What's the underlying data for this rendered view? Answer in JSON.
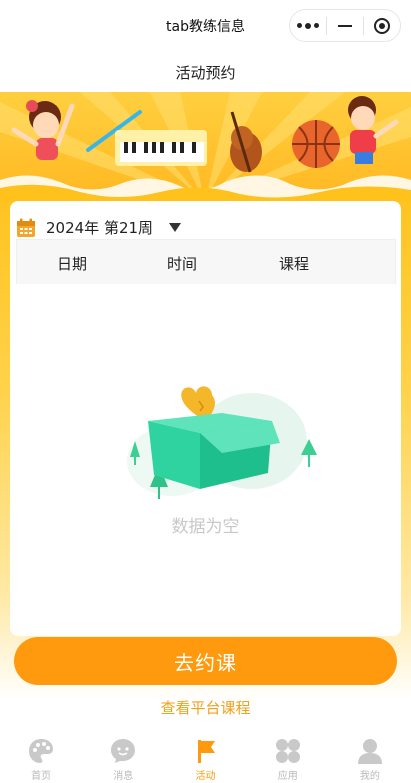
{
  "window": {
    "title": "tab教练信息"
  },
  "page": {
    "heading": "活动预约"
  },
  "schedule": {
    "week_label": "2024年 第21周",
    "columns": [
      "日期",
      "时间",
      "课程"
    ],
    "empty_text": "数据为空"
  },
  "actions": {
    "primary_label": "去约课",
    "link_label": "查看平台课程"
  },
  "tabbar": {
    "items": [
      {
        "label": "首页",
        "icon": "palette-icon"
      },
      {
        "label": "消息",
        "icon": "chat-bubble-icon"
      },
      {
        "label": "活动",
        "icon": "flag-icon",
        "active": true
      },
      {
        "label": "应用",
        "icon": "apps-grid-icon"
      },
      {
        "label": "我的",
        "icon": "user-icon"
      }
    ]
  },
  "colors": {
    "accent": "#ff9a0e",
    "banner": "#ffc21c",
    "inactive": "#b9b9b9"
  }
}
